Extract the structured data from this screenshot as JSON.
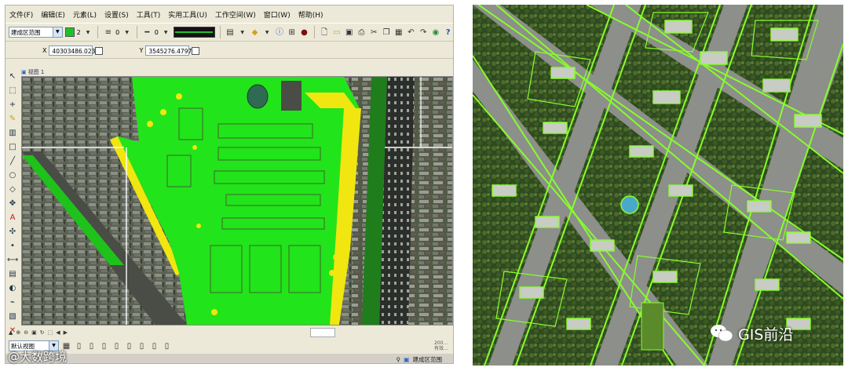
{
  "menu": [
    "文件(F)",
    "编辑(E)",
    "元素(L)",
    "设置(S)",
    "工具(T)",
    "实用工具(U)",
    "工作空间(W)",
    "窗口(W)",
    "帮助(H)"
  ],
  "toolbar": {
    "layer_select": "建成区范围",
    "color_value": "2",
    "line_weight": "0",
    "line_style": "0"
  },
  "coords": {
    "x_label": "X",
    "x_value": "40303486.0235",
    "y_label": "Y",
    "y_value": "3545276.4797"
  },
  "map_view": {
    "title": "视图 1"
  },
  "bottom": {
    "view_select": "默认视图",
    "active_layer": "建成区范围",
    "side_text": "200…\n有效…"
  },
  "watermarks": {
    "left": "@大数跨境",
    "right": "GIS前沿"
  },
  "colors": {
    "vector_fill": "#22e41a",
    "vector_highlight": "#f1e60f",
    "vector_outline": "#86ff2a",
    "road": "#8d8f8a"
  }
}
